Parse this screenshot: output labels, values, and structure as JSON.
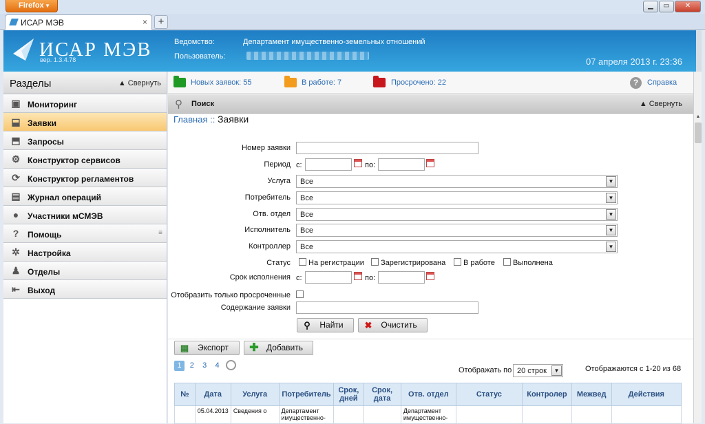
{
  "browser": {
    "menu_label": "Firefox",
    "tab_title": "ИСАР МЭВ",
    "new_tab": "+",
    "tab_close": "×",
    "win_min": "▁",
    "win_max": "▭",
    "win_close": "✕"
  },
  "header": {
    "logo_text": "ИСАР МЭВ",
    "version": "вер. 1.3.4.78",
    "dept_label": "Ведомство:",
    "dept_value": "Департамент имущественно-земельных отношений",
    "user_label": "Пользователь:",
    "datetime": "07 апреля 2013 г.   23:36"
  },
  "sidebar": {
    "title": "Разделы",
    "collapse": "▲ Свернуть",
    "items": [
      {
        "label": "Мониторинг",
        "icon": "monitor-icon"
      },
      {
        "label": "Заявки",
        "icon": "inbox-icon"
      },
      {
        "label": "Запросы",
        "icon": "outbox-icon"
      },
      {
        "label": "Конструктор сервисов",
        "icon": "gear-icon"
      },
      {
        "label": "Конструктор регламентов",
        "icon": "gear-cycle-icon"
      },
      {
        "label": "Журнал операций",
        "icon": "book-icon"
      },
      {
        "label": "Участники мСМЭВ",
        "icon": "user-icon"
      },
      {
        "label": "Помощь",
        "icon": "help-icon"
      },
      {
        "label": "Настройка",
        "icon": "settings-icon"
      },
      {
        "label": "Отделы",
        "icon": "group-icon"
      },
      {
        "label": "Выход",
        "icon": "exit-icon"
      }
    ],
    "active_index": 1
  },
  "status": {
    "new": "Новых заявок: 55",
    "in_work": "В работе: 7",
    "overdue": "Просрочено: 22",
    "help": "Справка",
    "colors": {
      "new": "#1e9a25",
      "in_work": "#f29b1d",
      "overdue": "#c8161d"
    }
  },
  "search": {
    "title": "Поиск",
    "collapse": "▲ Свернуть"
  },
  "breadcrumb": {
    "home": "Главная ::",
    "current": "Заявки"
  },
  "form": {
    "number_label": "Номер заявки",
    "period_label": "Период",
    "from": "с:",
    "to": "по:",
    "service_label": "Услуга",
    "consumer_label": "Потребитель",
    "dept_label": "Отв. отдел",
    "executor_label": "Исполнитель",
    "controller_label": "Контроллер",
    "select_value": "Все",
    "status_label": "Статус",
    "status_options": [
      "На регистрации",
      "Зарегистрирована",
      "В работе",
      "Выполнена"
    ],
    "deadline_label": "Срок исполнения",
    "overdue_only_label": "Отобразить только просроченные",
    "content_label": "Содержание заявки",
    "find_btn": "Найти",
    "clear_btn": "Очистить"
  },
  "toolbar": {
    "export_btn": "Экспорт",
    "add_btn": "Добавить"
  },
  "pager": {
    "pages": [
      "1",
      "2",
      "3",
      "4"
    ],
    "current": "1",
    "show_label": "Отображать по",
    "show_value": "20 строк",
    "summary": "Отображаются с 1-20 из 68"
  },
  "table": {
    "headers": [
      "№",
      "Дата",
      "Услуга",
      "Потребитель",
      "Срок, дней",
      "Срок, дата",
      "Отв. отдел",
      "Статус",
      "Контролер",
      "Межвед",
      "Действия"
    ],
    "row": [
      "",
      "05.04.2013",
      "Сведения о",
      "Департамент имущественно-",
      "",
      "",
      "Департамент имущественно-",
      "",
      "",
      "",
      ""
    ]
  }
}
